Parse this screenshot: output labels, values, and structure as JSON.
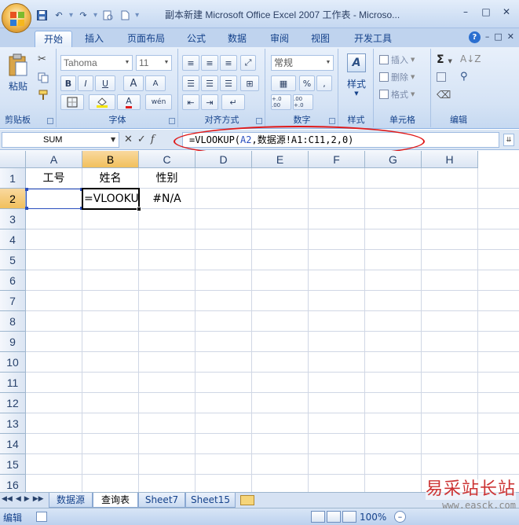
{
  "window": {
    "title": "副本新建 Microsoft Office Excel 2007 工作表 - Microso...",
    "controls": [
      "–",
      "□",
      "✕"
    ]
  },
  "ribbon_tabs": [
    "开始",
    "插入",
    "页面布局",
    "公式",
    "数据",
    "审阅",
    "视图",
    "开发工具"
  ],
  "ribbon_right": {
    "help": "?",
    "min": "–",
    "restore": "□",
    "close": "✕"
  },
  "ribbon": {
    "clipboard": {
      "label": "剪贴板",
      "paste": "粘贴"
    },
    "font": {
      "label": "字体",
      "name": "Tahoma",
      "size": "11",
      "bold": "B",
      "italic": "I",
      "underline": "U",
      "grow": "A",
      "shrink": "A",
      "color": "A",
      "phonetic": "wén"
    },
    "alignment": {
      "label": "对齐方式"
    },
    "number": {
      "label": "数字",
      "format": "常规",
      "percent": "%",
      "comma": ",",
      "inc": "+.0 .00",
      "dec": ".00 +.0"
    },
    "styles": {
      "label": "样式",
      "button": "样式"
    },
    "cells": {
      "label": "单元格",
      "insert": "插入",
      "delete": "删除",
      "format": "格式"
    },
    "editing": {
      "label": "编辑",
      "sum": "Σ"
    }
  },
  "formula_bar": {
    "name_box": "SUM",
    "formula_prefix": "=VLOOKUP(",
    "formula_ref": "A2",
    "formula_suffix": ",数据源!A1:C11,2,0)"
  },
  "columns": [
    "A",
    "B",
    "C",
    "D",
    "E",
    "F",
    "G",
    "H"
  ],
  "rows": [
    "1",
    "2",
    "3",
    "4",
    "5",
    "6",
    "7",
    "8",
    "9",
    "10",
    "11",
    "12",
    "13",
    "14",
    "15",
    "16"
  ],
  "cells": {
    "A1": "工号",
    "B1": "姓名",
    "C1": "性别",
    "B2": "=VLOOKUP",
    "C2": "#N/A"
  },
  "sheet_tabs": [
    "数据源",
    "查询表",
    "Sheet7",
    "Sheet15"
  ],
  "sheet_nav": [
    "◀◀",
    "◀",
    "▶",
    "▶▶"
  ],
  "status": {
    "mode": "编辑",
    "zoom": "100%",
    "zoom_out": "–"
  },
  "watermark": {
    "text": "易采站长站",
    "url": "www.easck.com"
  }
}
